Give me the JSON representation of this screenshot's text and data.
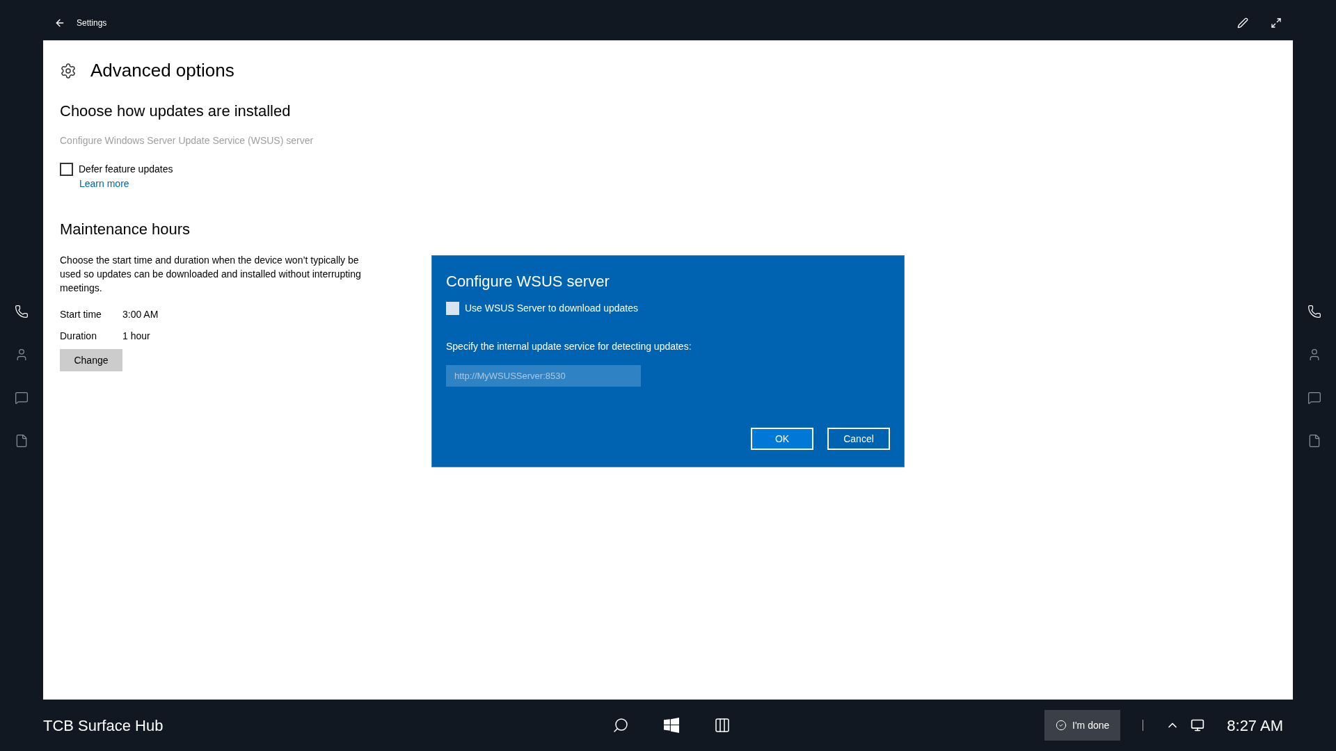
{
  "top_bar": {
    "title": "Settings"
  },
  "page": {
    "title": "Advanced options",
    "sections": [
      {
        "heading": "Choose how updates are installed",
        "link": {
          "label": "Configure Windows Server Update Service (WSUS) server",
          "disabled": true
        },
        "checkbox": {
          "label": "Defer feature updates",
          "checked": false
        },
        "learn_more": "Learn more"
      },
      {
        "heading": "Maintenance hours",
        "description": "Choose the start time and duration when the device won’t typically be used so updates can be downloaded and installed without interrupting meetings.",
        "rows": [
          {
            "label": "Start time",
            "value": "3:00 AM"
          },
          {
            "label": "Duration",
            "value": "1 hour"
          }
        ],
        "button": "Change"
      }
    ]
  },
  "dialog": {
    "title": "Configure WSUS server",
    "checkbox": {
      "label": "Use WSUS Server to download updates",
      "checked": false
    },
    "prompt": "Specify the internal update service for detecting updates:",
    "field": {
      "placeholder": "http://MyWSUSServer:8530"
    },
    "buttons": [
      {
        "label": "OK",
        "selected": true
      },
      {
        "label": "Cancel",
        "selected": false
      }
    ]
  },
  "taskbar": {
    "device_name": "TCB Surface Hub",
    "done_button": "I'm done",
    "time": "8:27 AM"
  }
}
